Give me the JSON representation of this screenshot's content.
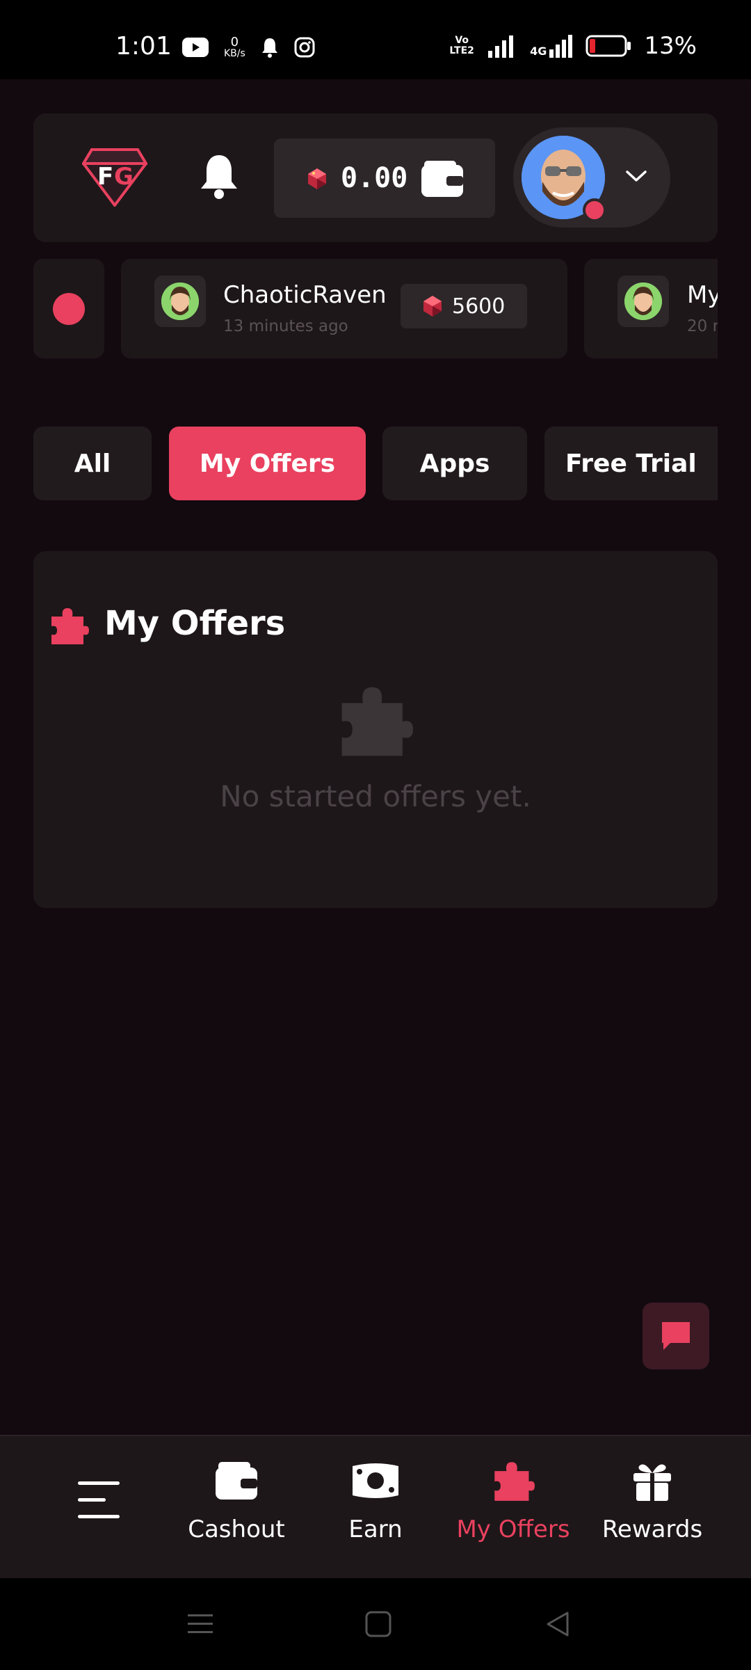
{
  "status_bar": {
    "time": "1:01",
    "net_speed_value": "0",
    "net_speed_unit": "KB/s",
    "volte": "Vo LTE2",
    "network": "4G",
    "battery": "13%",
    "icons": [
      "youtube-icon",
      "bell-icon",
      "instagram-icon",
      "signal-icon",
      "battery-icon"
    ]
  },
  "header": {
    "balance": "0.00",
    "icons": [
      "fg-logo",
      "bell-icon",
      "gem-icon",
      "wallet-icon",
      "avatar",
      "chevron-down-icon"
    ]
  },
  "activity_feed": [
    {
      "name": "ChaoticRaven",
      "time": "13 minutes ago",
      "amount": "5600"
    },
    {
      "name": "My",
      "time": "20 r"
    }
  ],
  "tabs": [
    {
      "label": "All",
      "active": false
    },
    {
      "label": "My Offers",
      "active": true
    },
    {
      "label": "Apps",
      "active": false
    },
    {
      "label": "Free Trial",
      "active": false
    }
  ],
  "offers_section": {
    "title": "My Offers",
    "empty_text": "No started offers yet."
  },
  "bottom_nav": [
    {
      "label": "",
      "icon": "menu-icon",
      "active": false
    },
    {
      "label": "Cashout",
      "icon": "wallet-icon",
      "active": false
    },
    {
      "label": "Earn",
      "icon": "money-icon",
      "active": false
    },
    {
      "label": "My Offers",
      "icon": "puzzle-icon",
      "active": true
    },
    {
      "label": "Rewards",
      "icon": "gift-icon",
      "active": false
    }
  ],
  "colors": {
    "accent": "#e9415f",
    "background": "#130a10",
    "card": "#1e1719",
    "pill": "#2d2729"
  }
}
